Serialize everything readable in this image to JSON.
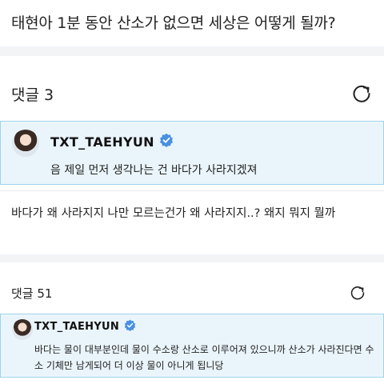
{
  "question": {
    "text": "태현아 1분 동안 산소가 없으면 세상은 어떻게 될까?"
  },
  "comments_section_1": {
    "label": "댓글 3"
  },
  "reply_1": {
    "username": "TXT_TAEHYUN",
    "text": "음 제일 먼저 생각나는 건 바다가 사라지겠져"
  },
  "user_comment": {
    "text": "바다가 왜 사라지지 나만 모르는건가 왜 사라지지..? 왜지 뭐지 뭘까"
  },
  "comments_section_2": {
    "label": "댓글 51"
  },
  "reply_2": {
    "username": "TXT_TAEHYUN",
    "text": "바다는 물이 대부분인데 물이 수소랑 산소로 이루어져 있으니까 산소가 사라진다면 수소 기체만 남게되어 더 이상 물이 아니게 됩니당"
  },
  "colors": {
    "reply_background": "#eaf5fb",
    "reply_border": "#9fd3ea",
    "verified_badge": "#4a90e2",
    "section_gap": "#f2f4f6"
  },
  "icons": {
    "refresh": "refresh-icon",
    "verified": "verified-badge-icon",
    "avatar": "avatar"
  }
}
